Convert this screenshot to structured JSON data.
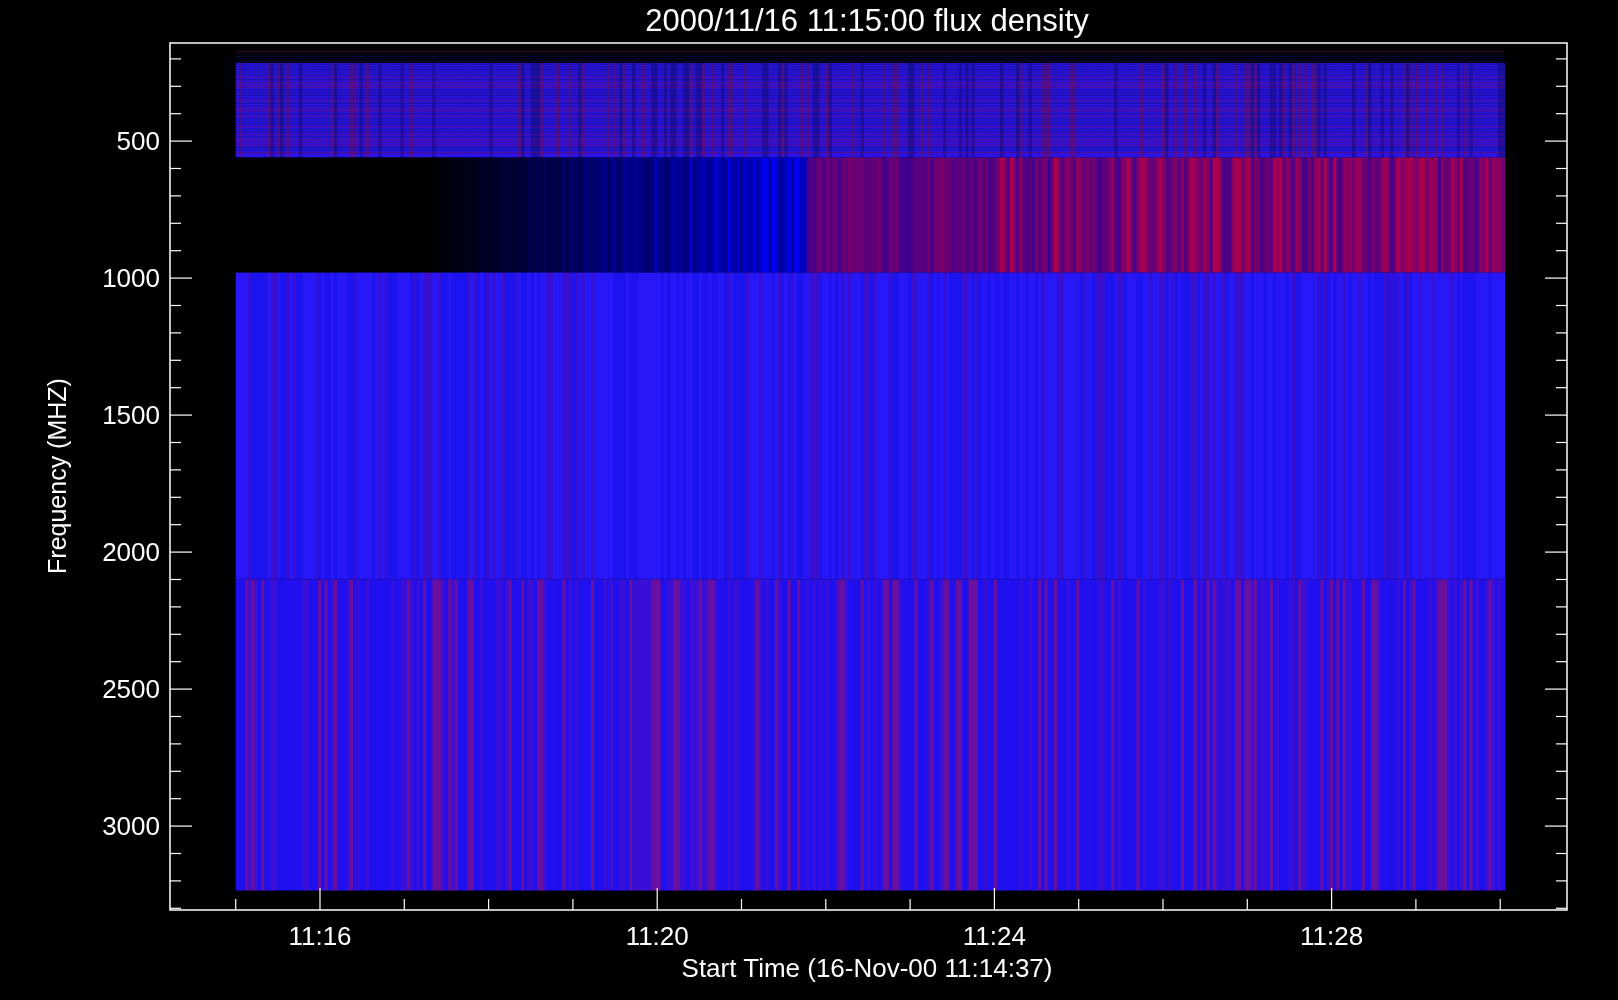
{
  "title": "2000/11/16 11:15:00 flux density",
  "x_axis": {
    "label": "Start Time (16-Nov-00 11:14:37)",
    "ticks": [
      "11:16",
      "11:20",
      "11:24",
      "11:28"
    ]
  },
  "y_axis": {
    "label": "Frequency (MHZ)",
    "ticks": [
      "500",
      "1000",
      "1500",
      "2000",
      "2500",
      "3000"
    ]
  }
}
